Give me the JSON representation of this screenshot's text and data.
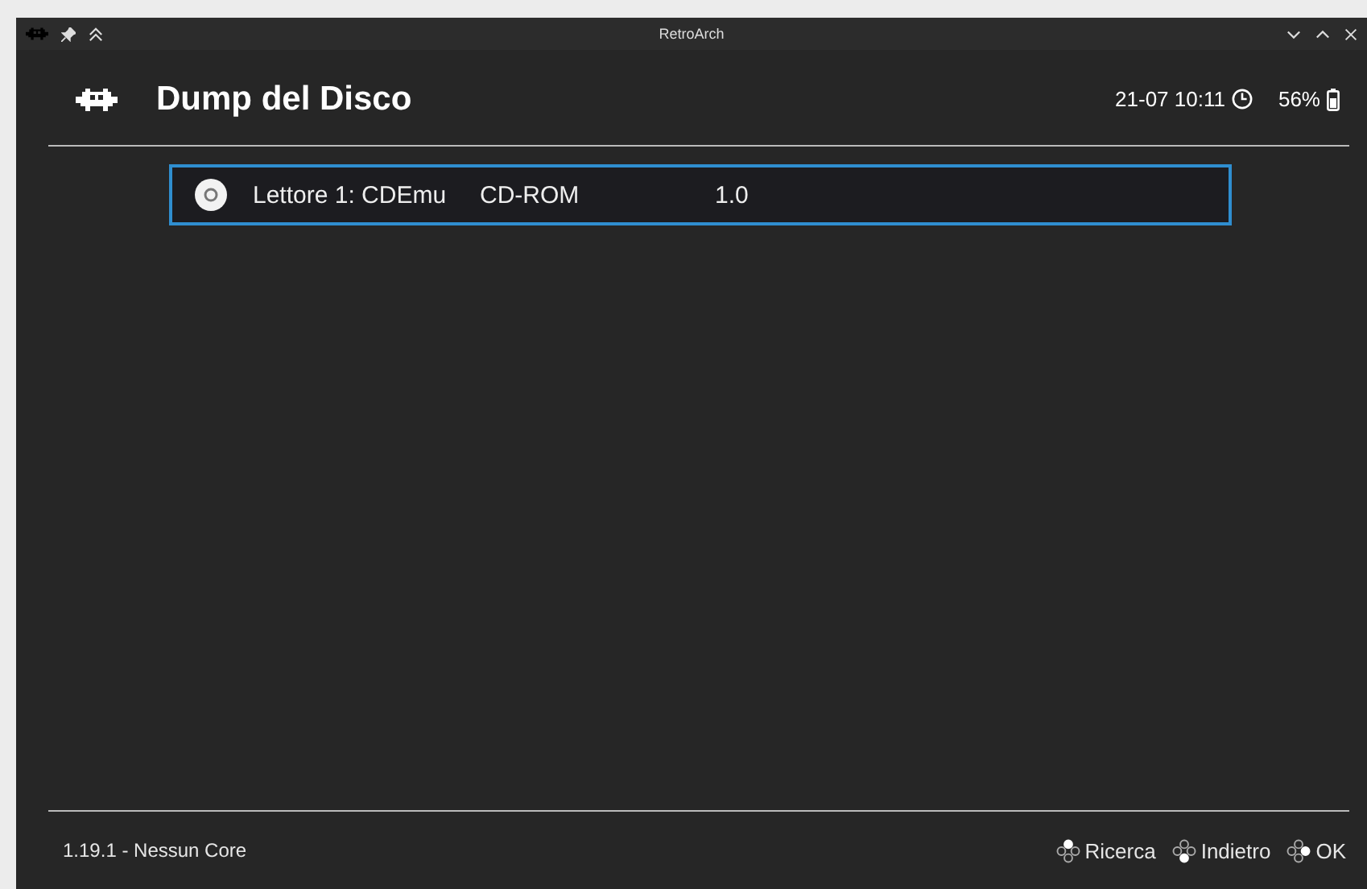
{
  "window": {
    "title": "RetroArch"
  },
  "header": {
    "title": "Dump del Disco",
    "clock": "21-07 10:11",
    "battery": "56%"
  },
  "items": [
    {
      "label": "Lettore 1: CDEmu",
      "type": "CD-ROM",
      "version": "1.0",
      "selected": true
    }
  ],
  "status_bar": {
    "version": "1.19.1 - Nessun Core",
    "hints": [
      {
        "label": "Ricerca",
        "kind": "top"
      },
      {
        "label": "Indietro",
        "kind": "bottom"
      },
      {
        "label": "OK",
        "kind": "right"
      }
    ]
  }
}
